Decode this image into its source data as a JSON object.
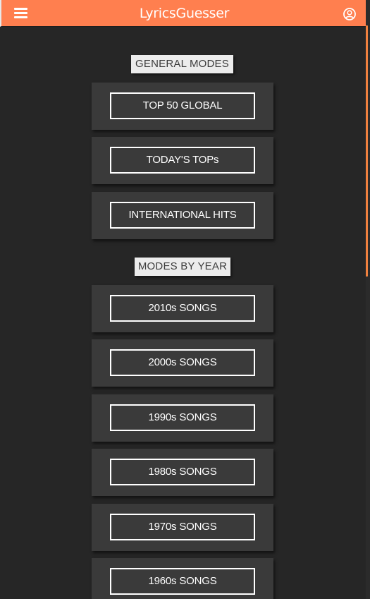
{
  "app": {
    "title": "LyricsGuesser"
  },
  "icons": {
    "menu": "hamburger-menu-icon",
    "account": "account-circle-icon"
  },
  "colors": {
    "app_bar": "#ff7f4f",
    "background": "#262626",
    "card": "#3a3a3a",
    "label_bg": "#ececec"
  },
  "sections": [
    {
      "label": "GENERAL MODES",
      "modes": [
        "TOP 50 GLOBAL",
        "TODAY'S TOPs",
        "INTERNATIONAL HITS"
      ]
    },
    {
      "label": "MODES BY YEAR",
      "modes": [
        "2010s SONGS",
        "2000s SONGS",
        "1990s SONGS",
        "1980s SONGS",
        "1970s SONGS",
        "1960s SONGS"
      ]
    }
  ]
}
